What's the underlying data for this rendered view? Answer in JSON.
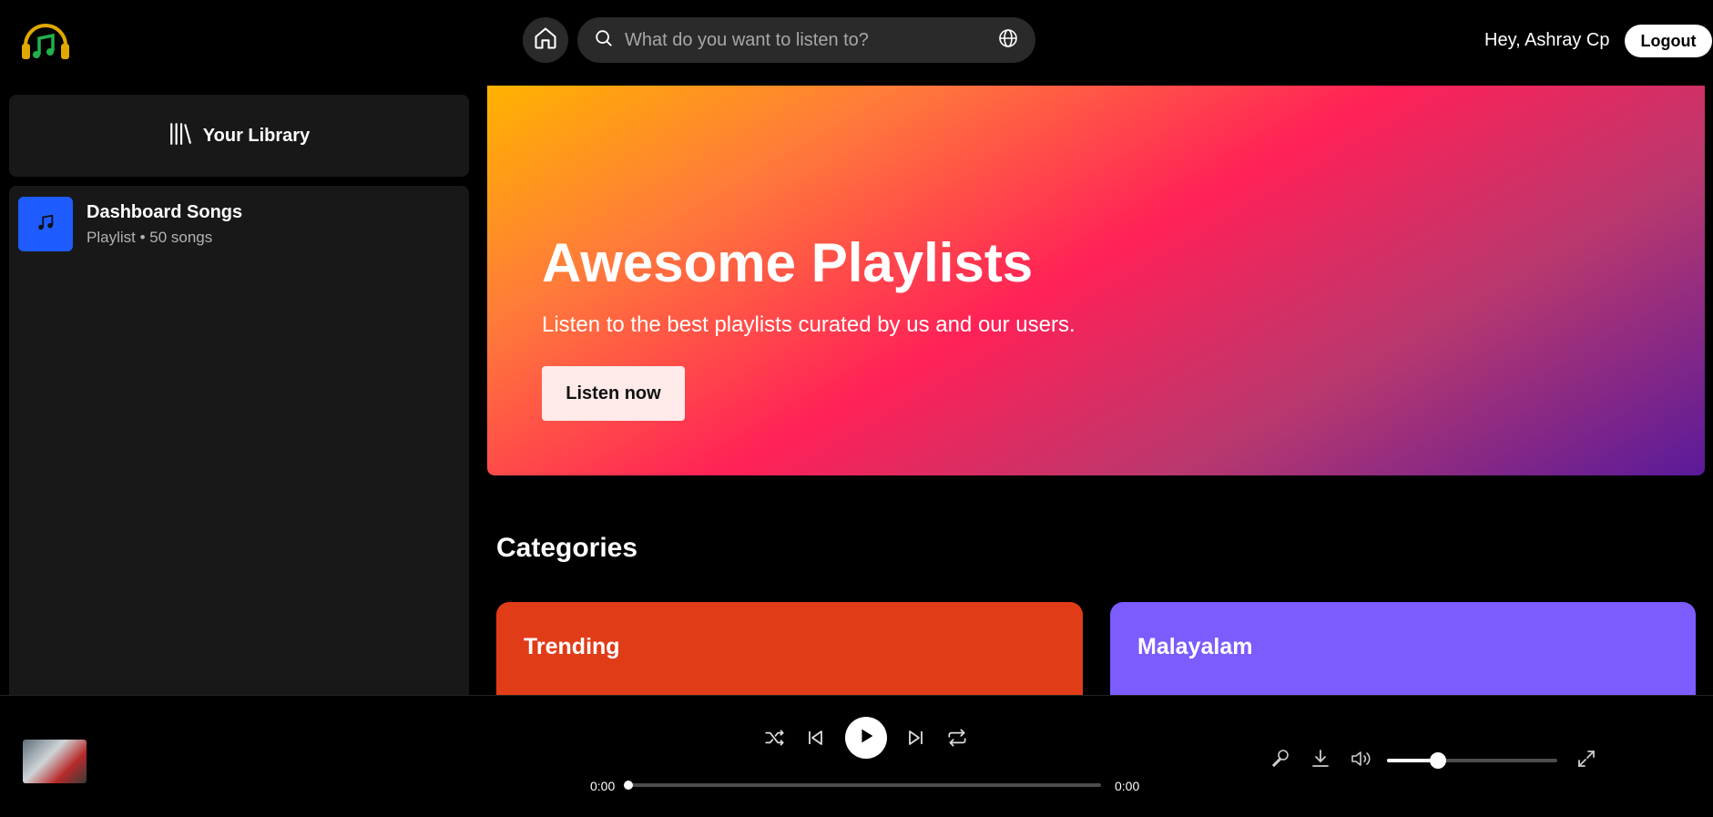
{
  "header": {
    "logo_icon": "headphones-music-logo-icon",
    "home_icon": "home-icon",
    "search": {
      "placeholder": "What do you want to listen to?",
      "value": ""
    },
    "globe_icon": "globe-icon",
    "greeting": "Hey, Ashray Cp",
    "logout_label": "Logout"
  },
  "sidebar": {
    "library_label": "Your Library",
    "library_icon": "library-icon",
    "playlists": [
      {
        "title": "Dashboard Songs",
        "subtitle": "Playlist • 50 songs",
        "icon": "music-note-icon",
        "color": "#1e5cff"
      }
    ]
  },
  "hero": {
    "title": "Awesome Playlists",
    "subtitle": "Listen to the best playlists curated by us and our users.",
    "button_label": "Listen now"
  },
  "categories": {
    "title": "Categories",
    "items": [
      {
        "label": "Trending",
        "color": "#e13c18"
      },
      {
        "label": "Malayalam",
        "color": "#7c5cfc"
      }
    ]
  },
  "player": {
    "current_time": "0:00",
    "duration": "0:00",
    "progress": 0,
    "volume": 0.3,
    "controls": [
      "shuffle-icon",
      "previous-icon",
      "play-icon",
      "next-icon",
      "repeat-icon"
    ],
    "right_controls": [
      "lyrics-mic-icon",
      "download-icon",
      "volume-icon",
      "fullscreen-icon"
    ]
  },
  "colors": {
    "accent": "#1db954",
    "background": "#000000",
    "panel": "#181818"
  }
}
